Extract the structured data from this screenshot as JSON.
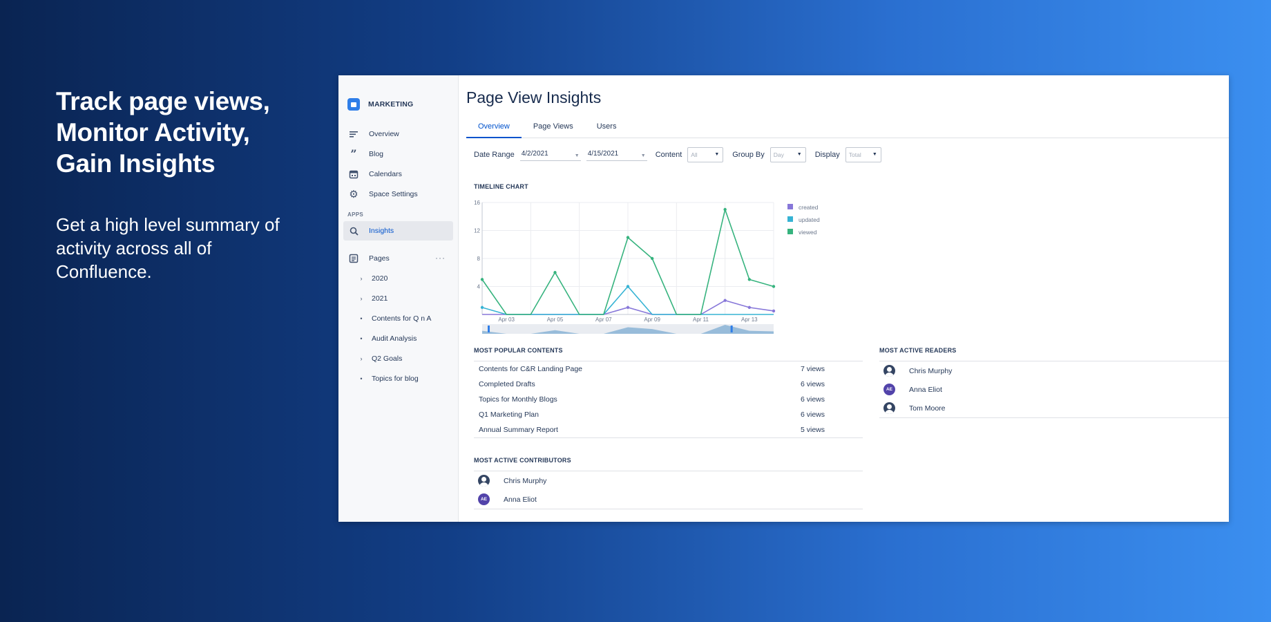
{
  "hero": {
    "title_lines": [
      "Track page views,",
      "Monitor Activity,",
      "Gain Insights"
    ],
    "subtitle": "Get a high level summary of activity across all of Confluence."
  },
  "sidebar": {
    "space_name": "MARKETING",
    "nav": [
      {
        "label": "Overview",
        "icon": "lines-icon"
      },
      {
        "label": "Blog",
        "icon": "quote-icon"
      },
      {
        "label": "Calendars",
        "icon": "calendar-icon"
      },
      {
        "label": "Space Settings",
        "icon": "gear-icon"
      }
    ],
    "apps_label": "APPS",
    "active_app": {
      "label": "Insights",
      "icon": "search-icon"
    },
    "pages_label": "Pages",
    "tree": [
      {
        "label": "2020",
        "expandable": true
      },
      {
        "label": "2021",
        "expandable": true
      },
      {
        "label": "Contents for Q n A",
        "expandable": false
      },
      {
        "label": "Audit Analysis",
        "expandable": false
      },
      {
        "label": "Q2 Goals",
        "expandable": true
      },
      {
        "label": "Topics for blog",
        "expandable": false
      }
    ]
  },
  "main": {
    "title": "Page View Insights",
    "tabs": [
      {
        "label": "Overview",
        "active": true
      },
      {
        "label": "Page Views",
        "active": false
      },
      {
        "label": "Users",
        "active": false
      }
    ],
    "filters": {
      "date_range_label": "Date Range",
      "date_from": "4/2/2021",
      "date_to": "4/15/2021",
      "content_label": "Content",
      "content_value": "All",
      "group_by_label": "Group By",
      "group_by_value": "Day",
      "display_label": "Display",
      "display_value": "Total"
    },
    "timeline_heading": "TIMELINE CHART",
    "popular_heading": "MOST POPULAR CONTENTS",
    "popular": [
      {
        "name": "Contents for C&R Landing Page",
        "views": "7 views"
      },
      {
        "name": "Completed Drafts",
        "views": "6 views"
      },
      {
        "name": "Topics for Monthly Blogs",
        "views": "6 views"
      },
      {
        "name": "Q1 Marketing Plan",
        "views": "6 views"
      },
      {
        "name": "Annual Summary Report",
        "views": "5 views"
      }
    ],
    "contributors_heading": "MOST ACTIVE CONTRIBUTORS",
    "contributors": [
      {
        "name": "Chris Murphy",
        "avatar": "photo",
        "initials": ""
      },
      {
        "name": "Anna Eliot",
        "avatar": "initials",
        "initials": "AE"
      }
    ],
    "readers_heading": "MOST ACTIVE READERS",
    "readers": [
      {
        "name": "Chris Murphy",
        "avatar": "photo",
        "initials": ""
      },
      {
        "name": "Anna Eliot",
        "avatar": "initials",
        "initials": "AE"
      },
      {
        "name": "Tom Moore",
        "avatar": "photo",
        "initials": ""
      }
    ]
  },
  "chart_data": {
    "type": "line",
    "x": [
      "Apr 02",
      "Apr 03",
      "Apr 04",
      "Apr 05",
      "Apr 06",
      "Apr 07",
      "Apr 08",
      "Apr 09",
      "Apr 10",
      "Apr 11",
      "Apr 12",
      "Apr 13",
      "Apr 14"
    ],
    "x_tick_labels": [
      "Apr 03",
      "Apr 05",
      "Apr 07",
      "Apr 09",
      "Apr 11",
      "Apr 13"
    ],
    "y_ticks": [
      4,
      8,
      12,
      16
    ],
    "ylim": [
      0,
      16
    ],
    "series": [
      {
        "name": "created",
        "color": "#8777d9",
        "values": [
          0,
          0,
          0,
          0,
          0,
          0,
          1,
          0,
          0,
          0,
          2,
          1,
          0.5
        ]
      },
      {
        "name": "updated",
        "color": "#36b3d4",
        "values": [
          1,
          0,
          0,
          0,
          0,
          0,
          4,
          0,
          0,
          0,
          0,
          0,
          0
        ]
      },
      {
        "name": "viewed",
        "color": "#36b37e",
        "values": [
          5,
          0,
          0,
          6,
          0,
          0,
          11,
          8,
          0,
          0,
          15,
          5,
          4
        ]
      }
    ],
    "grid": true,
    "legend": "right"
  }
}
